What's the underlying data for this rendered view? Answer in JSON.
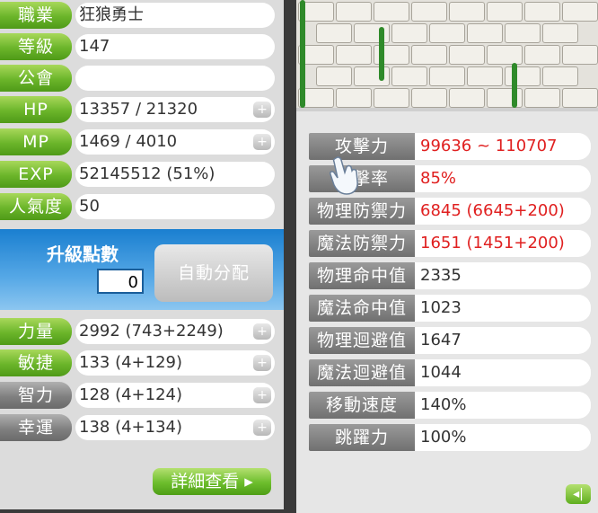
{
  "left_panel": {
    "rows": [
      {
        "label": "職業",
        "value": "狂狼勇士",
        "style": "green"
      },
      {
        "label": "等級",
        "value": "147",
        "style": "green"
      },
      {
        "label": "公會",
        "value": "",
        "style": "green"
      },
      {
        "label": "HP",
        "value": "13357 / 21320",
        "style": "green",
        "plus": "+"
      },
      {
        "label": "MP",
        "value": "1469 / 4010",
        "style": "green",
        "plus": "+"
      },
      {
        "label": "EXP",
        "value": "52145512 (51%)",
        "style": "green"
      },
      {
        "label": "人氣度",
        "value": "50",
        "style": "green"
      }
    ],
    "ability_points": {
      "label": "升級點數",
      "value": "0",
      "auto_button": "自動分配"
    },
    "stats": [
      {
        "label": "力量",
        "value": "2992 (743+2249)",
        "style": "green",
        "plus": "+"
      },
      {
        "label": "敏捷",
        "value": "133 (4+129)",
        "style": "green",
        "plus": "+"
      },
      {
        "label": "智力",
        "value": "128 (4+124)",
        "style": "gray",
        "plus": "+"
      },
      {
        "label": "幸運",
        "value": "138 (4+134)",
        "style": "gray",
        "plus": "+"
      }
    ],
    "detail_button": "詳細查看 ▸"
  },
  "right_panel": {
    "rows": [
      {
        "label": "攻擊力",
        "value": "99636 ~ 110707",
        "color": "red"
      },
      {
        "label": "爆擊率",
        "value": "85%",
        "color": "red"
      },
      {
        "label": "物理防禦力",
        "value": "6845 (6645+200)",
        "color": "red"
      },
      {
        "label": "魔法防禦力",
        "value": "1651 (1451+200)",
        "color": "red"
      },
      {
        "label": "物理命中值",
        "value": "2335",
        "color": "normal"
      },
      {
        "label": "魔法命中值",
        "value": "1023",
        "color": "normal"
      },
      {
        "label": "物理迴避值",
        "value": "1647",
        "color": "normal"
      },
      {
        "label": "魔法迴避值",
        "value": "1044",
        "color": "normal"
      },
      {
        "label": "移動速度",
        "value": "140%",
        "color": "normal"
      },
      {
        "label": "跳躍力",
        "value": "100%",
        "color": "normal"
      }
    ],
    "back_icon": "◂|"
  },
  "colors": {
    "green": "#6bb52a",
    "red": "#e02020",
    "blue": "#1a7fd0"
  }
}
